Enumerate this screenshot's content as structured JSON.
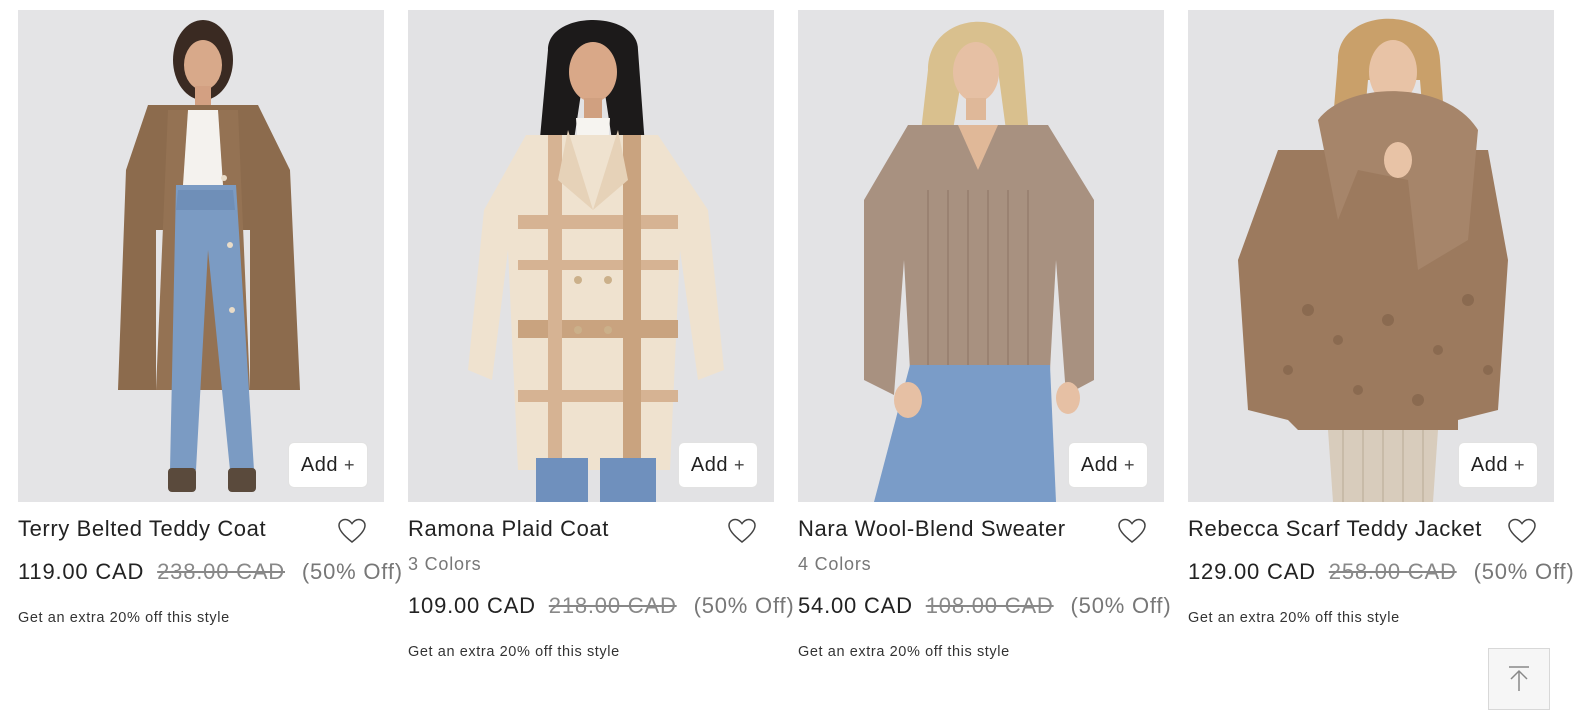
{
  "products": [
    {
      "name": "Terry Belted Teddy Coat",
      "colors": "",
      "price_now": "119.00 CAD",
      "price_was": "238.00 CAD",
      "discount": "(50% Off)",
      "promo": "Get an extra 20% off this style",
      "add_label": "Add",
      "add_icon": "+",
      "image_icon": "model-brown-teddy-coat-jeans",
      "accent": "#8a6a4c"
    },
    {
      "name": "Ramona Plaid Coat",
      "colors": "3 Colors",
      "price_now": "109.00 CAD",
      "price_was": "218.00 CAD",
      "discount": "(50% Off)",
      "promo": "Get an extra 20% off this style",
      "add_label": "Add",
      "add_icon": "+",
      "image_icon": "model-plaid-coat",
      "accent": "#d4b08c"
    },
    {
      "name": "Nara Wool-Blend Sweater",
      "colors": "4 Colors",
      "price_now": "54.00 CAD",
      "price_was": "108.00 CAD",
      "discount": "(50% Off)",
      "promo": "Get an extra 20% off this style",
      "add_label": "Add",
      "add_icon": "+",
      "image_icon": "model-taupe-sweater",
      "accent": "#a8907c"
    },
    {
      "name": "Rebecca Scarf Teddy Jacket",
      "colors": "",
      "price_now": "129.00 CAD",
      "price_was": "258.00 CAD",
      "discount": "(50% Off)",
      "promo": "Get an extra 20% off this style",
      "add_label": "Add",
      "add_icon": "+",
      "image_icon": "model-teddy-scarf-jacket",
      "accent": "#9a7558"
    }
  ],
  "back_to_top_icon": "arrow-up-icon",
  "colors": {
    "image_bg": "#e6e6e6",
    "text": "#222222",
    "muted": "#777777"
  }
}
